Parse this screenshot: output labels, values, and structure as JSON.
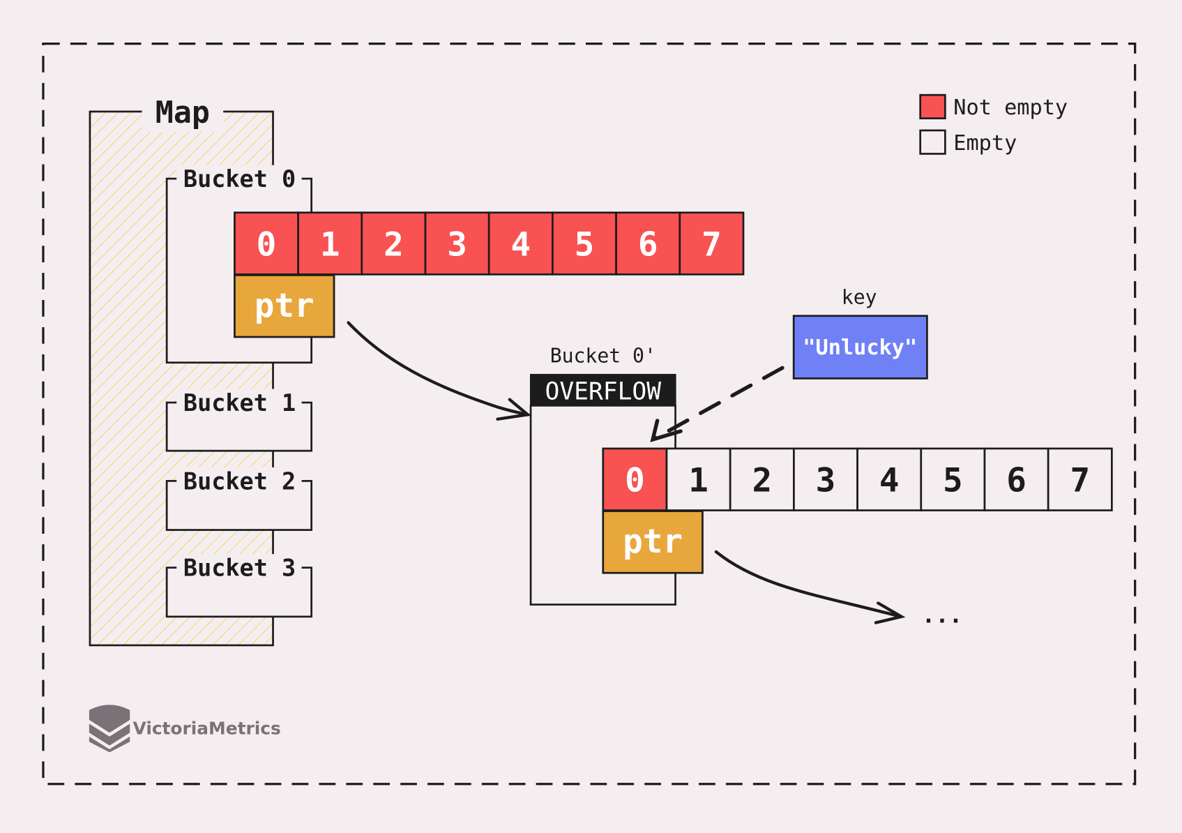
{
  "title": "Map",
  "colors": {
    "background": "#f5eef1",
    "not_empty": "#f85252",
    "empty": "#f5eef1",
    "pointer": "#e8a73c",
    "key": "#7080f5",
    "hatch": "#f3cf55",
    "line": "#1c1c1c"
  },
  "legend": [
    {
      "label": "Not empty",
      "state": "not_empty"
    },
    {
      "label": "Empty",
      "state": "empty"
    }
  ],
  "map": {
    "buckets": [
      {
        "label": "Bucket 0"
      },
      {
        "label": "Bucket 1"
      },
      {
        "label": "Bucket 2"
      },
      {
        "label": "Bucket 3"
      }
    ]
  },
  "bucket0": {
    "slots": [
      {
        "label": "0",
        "state": "not_empty"
      },
      {
        "label": "1",
        "state": "not_empty"
      },
      {
        "label": "2",
        "state": "not_empty"
      },
      {
        "label": "3",
        "state": "not_empty"
      },
      {
        "label": "4",
        "state": "not_empty"
      },
      {
        "label": "5",
        "state": "not_empty"
      },
      {
        "label": "6",
        "state": "not_empty"
      },
      {
        "label": "7",
        "state": "not_empty"
      }
    ],
    "ptr_label": "ptr"
  },
  "overflow_bucket": {
    "label": "Bucket 0'",
    "badge": "OVERFLOW",
    "slots": [
      {
        "label": "0",
        "state": "not_empty"
      },
      {
        "label": "1",
        "state": "empty"
      },
      {
        "label": "2",
        "state": "empty"
      },
      {
        "label": "3",
        "state": "empty"
      },
      {
        "label": "4",
        "state": "empty"
      },
      {
        "label": "5",
        "state": "empty"
      },
      {
        "label": "6",
        "state": "empty"
      },
      {
        "label": "7",
        "state": "empty"
      }
    ],
    "ptr_label": "ptr"
  },
  "key": {
    "caption": "key",
    "value": "\"Unlucky\""
  },
  "continuation": "...",
  "logo": {
    "text": "VictoriaMetrics"
  }
}
